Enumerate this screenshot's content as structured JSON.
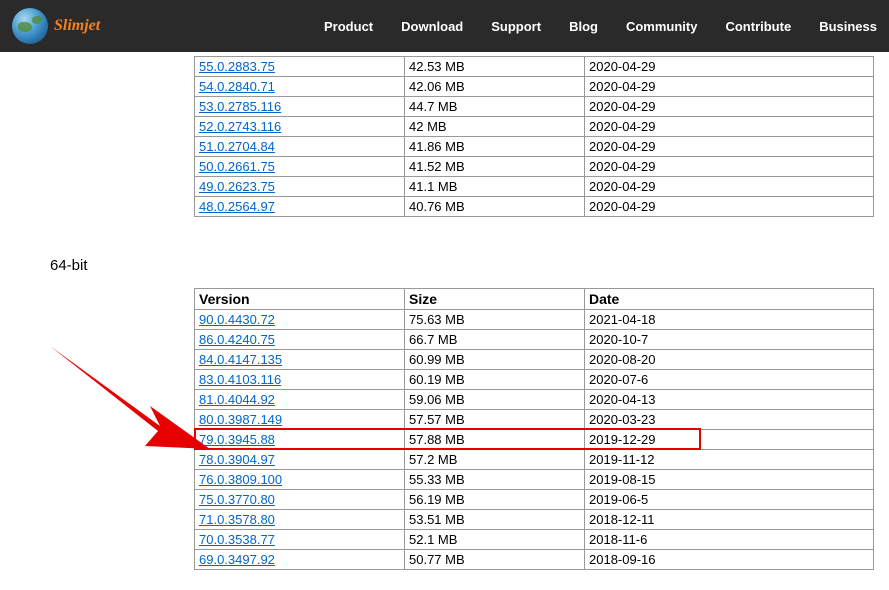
{
  "header": {
    "logo_text": "Slimjet",
    "nav": [
      "Product",
      "Download",
      "Support",
      "Blog",
      "Community",
      "Contribute",
      "Business"
    ]
  },
  "table1": {
    "rows": [
      {
        "version": "55.0.2883.75",
        "size": "42.53 MB",
        "date": "2020-04-29"
      },
      {
        "version": "54.0.2840.71",
        "size": "42.06 MB",
        "date": "2020-04-29"
      },
      {
        "version": "53.0.2785.116",
        "size": "44.7 MB",
        "date": "2020-04-29"
      },
      {
        "version": "52.0.2743.116",
        "size": "42 MB",
        "date": "2020-04-29"
      },
      {
        "version": "51.0.2704.84",
        "size": "41.86 MB",
        "date": "2020-04-29"
      },
      {
        "version": "50.0.2661.75",
        "size": "41.52 MB",
        "date": "2020-04-29"
      },
      {
        "version": "49.0.2623.75",
        "size": "41.1 MB",
        "date": "2020-04-29"
      },
      {
        "version": "48.0.2564.97",
        "size": "40.76 MB",
        "date": "2020-04-29"
      }
    ]
  },
  "section2_title": "64-bit",
  "table2": {
    "headers": {
      "version": "Version",
      "size": "Size",
      "date": "Date"
    },
    "rows": [
      {
        "version": "90.0.4430.72",
        "size": "75.63 MB",
        "date": "2021-04-18"
      },
      {
        "version": "86.0.4240.75",
        "size": "66.7 MB",
        "date": "2020-10-7"
      },
      {
        "version": "84.0.4147.135",
        "size": "60.99 MB",
        "date": "2020-08-20"
      },
      {
        "version": "83.0.4103.116",
        "size": "60.19 MB",
        "date": "2020-07-6"
      },
      {
        "version": "81.0.4044.92",
        "size": "59.06 MB",
        "date": "2020-04-13"
      },
      {
        "version": "80.0.3987.149",
        "size": "57.57 MB",
        "date": "2020-03-23"
      },
      {
        "version": "79.0.3945.88",
        "size": "57.88 MB",
        "date": "2019-12-29"
      },
      {
        "version": "78.0.3904.97",
        "size": "57.2 MB",
        "date": "2019-11-12"
      },
      {
        "version": "76.0.3809.100",
        "size": "55.33 MB",
        "date": "2019-08-15"
      },
      {
        "version": "75.0.3770.80",
        "size": "56.19 MB",
        "date": "2019-06-5"
      },
      {
        "version": "71.0.3578.80",
        "size": "53.51 MB",
        "date": "2018-12-11"
      },
      {
        "version": "70.0.3538.77",
        "size": "52.1 MB",
        "date": "2018-11-6"
      },
      {
        "version": "69.0.3497.92",
        "size": "50.77 MB",
        "date": "2018-09-16"
      }
    ]
  },
  "highlight": {
    "row_index": 6
  }
}
